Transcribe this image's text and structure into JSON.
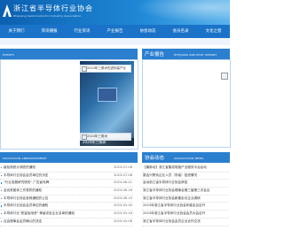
{
  "header": {
    "title": "浙江省半导体行业协会",
    "subtitle": "Zhejiang Semiconductor Industry Association"
  },
  "nav": [
    "关于我们",
    "资讯播报",
    "行业资讯",
    "产业报告",
    "协会动态",
    "会员名录",
    "文化之窗"
  ],
  "news": {
    "heading_en": "EVENTS",
    "image_caption": "2024年三角洲",
    "thumb1": "2024年三角洲先进封装产业",
    "thumb2": "2024年三角洲"
  },
  "report": {
    "heading_cn": "产业报告",
    "heading_en": "ZHEJIANG INDUSTRY REPORT"
  },
  "announcements": {
    "heading_en": "SSOCIATION ANNOUNCEMENT",
    "items": [
      {
        "title": "级检测统计调查的通知",
        "date": "2023-07-08"
      },
      {
        "title": "半导体行业协会会员单位的决定",
        "date": "2023-07-08"
      },
      {
        "title": "\"行业发展研究院的\" 广告宣传牌",
        "date": "2023-06-21"
      },
      {
        "title": "会优秀团体工作表彰的通知",
        "date": "2023-06-18"
      },
      {
        "title": "半导体行业协会官网通知的公告",
        "date": "2023-06-10"
      },
      {
        "title": "半导体行业协会会员单位的通知",
        "date": "2023-05-30"
      },
      {
        "title": "半导体行业\"质量信用资\" 等级评定企业名单的通知",
        "date": "2023-05-18"
      },
      {
        "title": "合会理事会会员确认的决定",
        "date": "2023-05-08"
      }
    ]
  },
  "assoc": {
    "heading_cn": "协会动态",
    "heading_en": "ASSOCIATION NEWS",
    "items": [
      "【最新动】浙江省集成电路产业服务平台启动",
      "委会兴联系企业人员（学者）投资情况",
      "会动浙江省半导体行业协会获奖",
      "浙江省半导体行业协会理事会第三届第三次会议",
      "浙江省半导体行业协会新春走访企业调研",
      "2023年浙江省半导体行业协会年度会议召开",
      "2023年浙江省半导体行业协会会员大会召开",
      "浙江省半导体行业协会会员企业合作交流"
    ]
  }
}
